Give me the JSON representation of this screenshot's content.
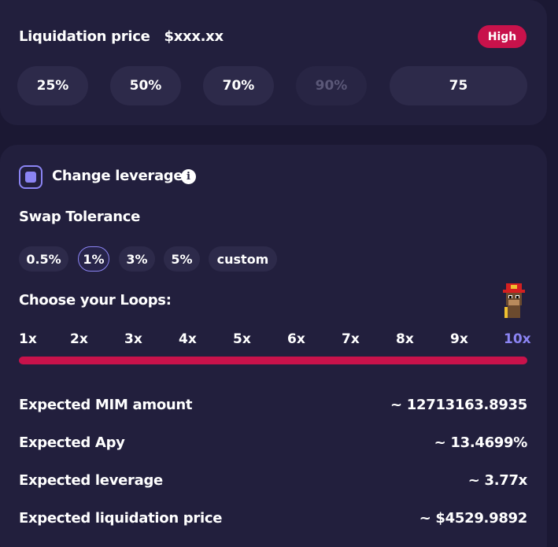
{
  "liquidation": {
    "label": "Liquidation price",
    "value": "$xxx.xx",
    "risk_badge": "High",
    "percent_buttons": [
      {
        "label": "25%",
        "enabled": true
      },
      {
        "label": "50%",
        "enabled": true
      },
      {
        "label": "70%",
        "enabled": true
      },
      {
        "label": "90%",
        "enabled": false
      }
    ],
    "custom_value": "75"
  },
  "leverage": {
    "checkbox_checked": true,
    "label": "Change leverage",
    "info_icon": "info-icon"
  },
  "swap_tolerance": {
    "title": "Swap Tolerance",
    "options": [
      "0.5%",
      "1%",
      "3%",
      "5%",
      "custom"
    ],
    "selected": "1%"
  },
  "loops": {
    "title": "Choose your Loops:",
    "options": [
      "1x",
      "2x",
      "3x",
      "4x",
      "5x",
      "6x",
      "7x",
      "8x",
      "9x",
      "10x"
    ],
    "selected": "10x",
    "avatar_icon": "ape-avatar-icon"
  },
  "expected": [
    {
      "label": "Expected MIM amount",
      "value": "~ 12713163.8935"
    },
    {
      "label": "Expected Apy",
      "value": "~ 13.4699%"
    },
    {
      "label": "Expected leverage",
      "value": "~ 3.77x"
    },
    {
      "label": "Expected liquidation price",
      "value": "~ $4529.9892"
    }
  ],
  "colors": {
    "background": "#1b1833",
    "panel": "#221f3d",
    "button": "#2d2a4a",
    "accent": "#8b84f3",
    "danger": "#c8124b"
  }
}
